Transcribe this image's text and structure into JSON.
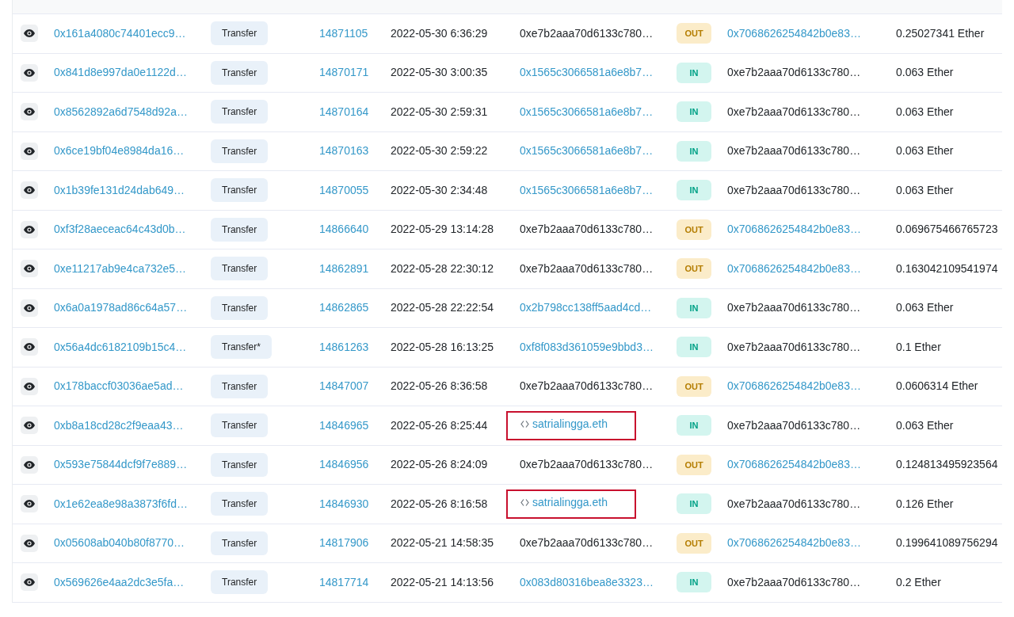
{
  "transactions": [
    {
      "hash": "0x161a4080c74401ecc9…",
      "method": "Transfer",
      "block": "14871105",
      "date": "2022-05-30 6:36:29",
      "from": {
        "text": "0xe7b2aaa70d6133c780…",
        "kind": "address",
        "link": false,
        "highlighted": false
      },
      "direction": "OUT",
      "to": {
        "text": "0x7068626254842b0e83…",
        "link": true
      },
      "value": "0.25027341 Ether"
    },
    {
      "hash": "0x841d8e997da0e1122d…",
      "method": "Transfer",
      "block": "14870171",
      "date": "2022-05-30 3:00:35",
      "from": {
        "text": "0x1565c3066581a6e8b7…",
        "kind": "address",
        "link": true,
        "highlighted": false
      },
      "direction": "IN",
      "to": {
        "text": "0xe7b2aaa70d6133c780…",
        "link": false
      },
      "value": "0.063 Ether"
    },
    {
      "hash": "0x8562892a6d7548d92a…",
      "method": "Transfer",
      "block": "14870164",
      "date": "2022-05-30 2:59:31",
      "from": {
        "text": "0x1565c3066581a6e8b7…",
        "kind": "address",
        "link": true,
        "highlighted": false
      },
      "direction": "IN",
      "to": {
        "text": "0xe7b2aaa70d6133c780…",
        "link": false
      },
      "value": "0.063 Ether"
    },
    {
      "hash": "0x6ce19bf04e8984da16…",
      "method": "Transfer",
      "block": "14870163",
      "date": "2022-05-30 2:59:22",
      "from": {
        "text": "0x1565c3066581a6e8b7…",
        "kind": "address",
        "link": true,
        "highlighted": false
      },
      "direction": "IN",
      "to": {
        "text": "0xe7b2aaa70d6133c780…",
        "link": false
      },
      "value": "0.063 Ether"
    },
    {
      "hash": "0x1b39fe131d24dab649…",
      "method": "Transfer",
      "block": "14870055",
      "date": "2022-05-30 2:34:48",
      "from": {
        "text": "0x1565c3066581a6e8b7…",
        "kind": "address",
        "link": true,
        "highlighted": false
      },
      "direction": "IN",
      "to": {
        "text": "0xe7b2aaa70d6133c780…",
        "link": false
      },
      "value": "0.063 Ether"
    },
    {
      "hash": "0xf3f28aeceac64c43d0b…",
      "method": "Transfer",
      "block": "14866640",
      "date": "2022-05-29 13:14:28",
      "from": {
        "text": "0xe7b2aaa70d6133c780…",
        "kind": "address",
        "link": false,
        "highlighted": false
      },
      "direction": "OUT",
      "to": {
        "text": "0x7068626254842b0e83…",
        "link": true
      },
      "value": "0.069675466765723"
    },
    {
      "hash": "0xe11217ab9e4ca732e5…",
      "method": "Transfer",
      "block": "14862891",
      "date": "2022-05-28 22:30:12",
      "from": {
        "text": "0xe7b2aaa70d6133c780…",
        "kind": "address",
        "link": false,
        "highlighted": false
      },
      "direction": "OUT",
      "to": {
        "text": "0x7068626254842b0e83…",
        "link": true
      },
      "value": "0.163042109541974"
    },
    {
      "hash": "0x6a0a1978ad86c64a57…",
      "method": "Transfer",
      "block": "14862865",
      "date": "2022-05-28 22:22:54",
      "from": {
        "text": "0x2b798cc138ff5aad4cd…",
        "kind": "address",
        "link": true,
        "highlighted": false
      },
      "direction": "IN",
      "to": {
        "text": "0xe7b2aaa70d6133c780…",
        "link": false
      },
      "value": "0.063 Ether"
    },
    {
      "hash": "0x56a4dc6182109b15c4…",
      "method": "Transfer*",
      "block": "14861263",
      "date": "2022-05-28 16:13:25",
      "from": {
        "text": "0xf8f083d361059e9bbd3…",
        "kind": "address",
        "link": true,
        "highlighted": false
      },
      "direction": "IN",
      "to": {
        "text": "0xe7b2aaa70d6133c780…",
        "link": false
      },
      "value": "0.1 Ether"
    },
    {
      "hash": "0x178baccf03036ae5ad…",
      "method": "Transfer",
      "block": "14847007",
      "date": "2022-05-26 8:36:58",
      "from": {
        "text": "0xe7b2aaa70d6133c780…",
        "kind": "address",
        "link": false,
        "highlighted": false
      },
      "direction": "OUT",
      "to": {
        "text": "0x7068626254842b0e83…",
        "link": true
      },
      "value": "0.0606314 Ether"
    },
    {
      "hash": "0xb8a18cd28c2f9eaa43…",
      "method": "Transfer",
      "block": "14846965",
      "date": "2022-05-26 8:25:44",
      "from": {
        "text": "satrialingga.eth",
        "kind": "ens",
        "link": true,
        "highlighted": true
      },
      "direction": "IN",
      "to": {
        "text": "0xe7b2aaa70d6133c780…",
        "link": false
      },
      "value": "0.063 Ether"
    },
    {
      "hash": "0x593e75844dcf9f7e889…",
      "method": "Transfer",
      "block": "14846956",
      "date": "2022-05-26 8:24:09",
      "from": {
        "text": "0xe7b2aaa70d6133c780…",
        "kind": "address",
        "link": false,
        "highlighted": false
      },
      "direction": "OUT",
      "to": {
        "text": "0x7068626254842b0e83…",
        "link": true
      },
      "value": "0.124813495923564"
    },
    {
      "hash": "0x1e62ea8e98a3873f6fd…",
      "method": "Transfer",
      "block": "14846930",
      "date": "2022-05-26 8:16:58",
      "from": {
        "text": "satrialingga.eth",
        "kind": "ens",
        "link": true,
        "highlighted": true
      },
      "direction": "IN",
      "to": {
        "text": "0xe7b2aaa70d6133c780…",
        "link": false
      },
      "value": "0.126 Ether"
    },
    {
      "hash": "0x05608ab040b80f8770…",
      "method": "Transfer",
      "block": "14817906",
      "date": "2022-05-21 14:58:35",
      "from": {
        "text": "0xe7b2aaa70d6133c780…",
        "kind": "address",
        "link": false,
        "highlighted": false
      },
      "direction": "OUT",
      "to": {
        "text": "0x7068626254842b0e83…",
        "link": true
      },
      "value": "0.199641089756294"
    },
    {
      "hash": "0x569626e4aa2dc3e5fa…",
      "method": "Transfer",
      "block": "14817714",
      "date": "2022-05-21 14:13:56",
      "from": {
        "text": "0x083d80316bea8e3323…",
        "kind": "address",
        "link": true,
        "highlighted": false
      },
      "direction": "IN",
      "to": {
        "text": "0xe7b2aaa70d6133c780…",
        "link": false
      },
      "value": "0.2 Ether"
    }
  ]
}
